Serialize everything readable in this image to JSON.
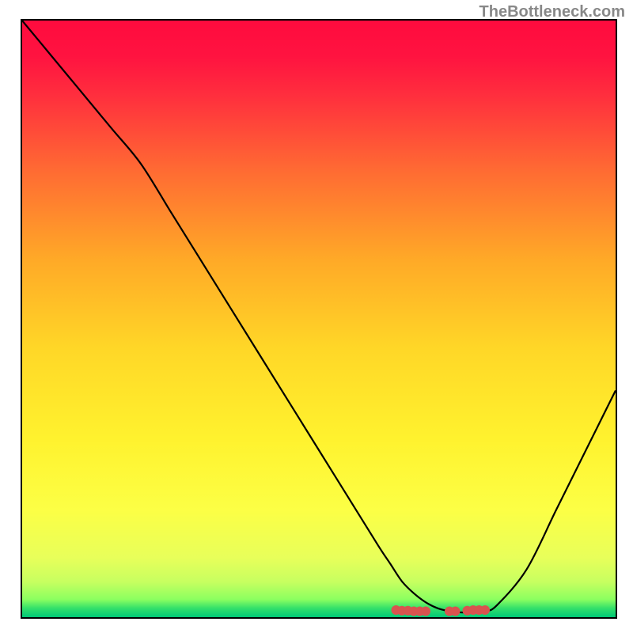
{
  "watermark": "TheBottleneck.com",
  "chart_data": {
    "type": "line",
    "title": "",
    "xlabel": "",
    "ylabel": "",
    "xlim": [
      0,
      100
    ],
    "ylim": [
      0,
      100
    ],
    "series": [
      {
        "name": "bottleneck-curve",
        "x": [
          0,
          5,
          10,
          15,
          20,
          25,
          30,
          35,
          40,
          45,
          50,
          55,
          60,
          62,
          64,
          66,
          68,
          70,
          72,
          74,
          76,
          78,
          80,
          85,
          90,
          95,
          100
        ],
        "y": [
          100,
          94,
          88,
          82,
          76,
          68,
          60,
          52,
          44,
          36,
          28,
          20,
          12,
          9,
          6,
          4,
          2.5,
          1.5,
          1,
          0.8,
          0.8,
          1,
          2,
          8,
          18,
          28,
          38
        ]
      }
    ],
    "markers": {
      "name": "highlight-points",
      "x": [
        63,
        64,
        65,
        66,
        67,
        68,
        72,
        73,
        75,
        76,
        77,
        78
      ],
      "y": [
        1.2,
        1.1,
        1.1,
        1.0,
        1.0,
        1.0,
        1.0,
        1.0,
        1.1,
        1.2,
        1.2,
        1.2
      ],
      "color": "#d9534f"
    },
    "gradient_stops": [
      {
        "offset": 0.0,
        "color": "#ff0b3e"
      },
      {
        "offset": 0.06,
        "color": "#ff1340"
      },
      {
        "offset": 0.12,
        "color": "#ff2c3e"
      },
      {
        "offset": 0.25,
        "color": "#ff6a33"
      },
      {
        "offset": 0.4,
        "color": "#ffa927"
      },
      {
        "offset": 0.55,
        "color": "#ffd727"
      },
      {
        "offset": 0.7,
        "color": "#fff22e"
      },
      {
        "offset": 0.82,
        "color": "#fcff45"
      },
      {
        "offset": 0.9,
        "color": "#e8ff5a"
      },
      {
        "offset": 0.94,
        "color": "#c8ff60"
      },
      {
        "offset": 0.97,
        "color": "#8cff60"
      },
      {
        "offset": 0.985,
        "color": "#33e06a"
      },
      {
        "offset": 1.0,
        "color": "#00c977"
      }
    ]
  }
}
